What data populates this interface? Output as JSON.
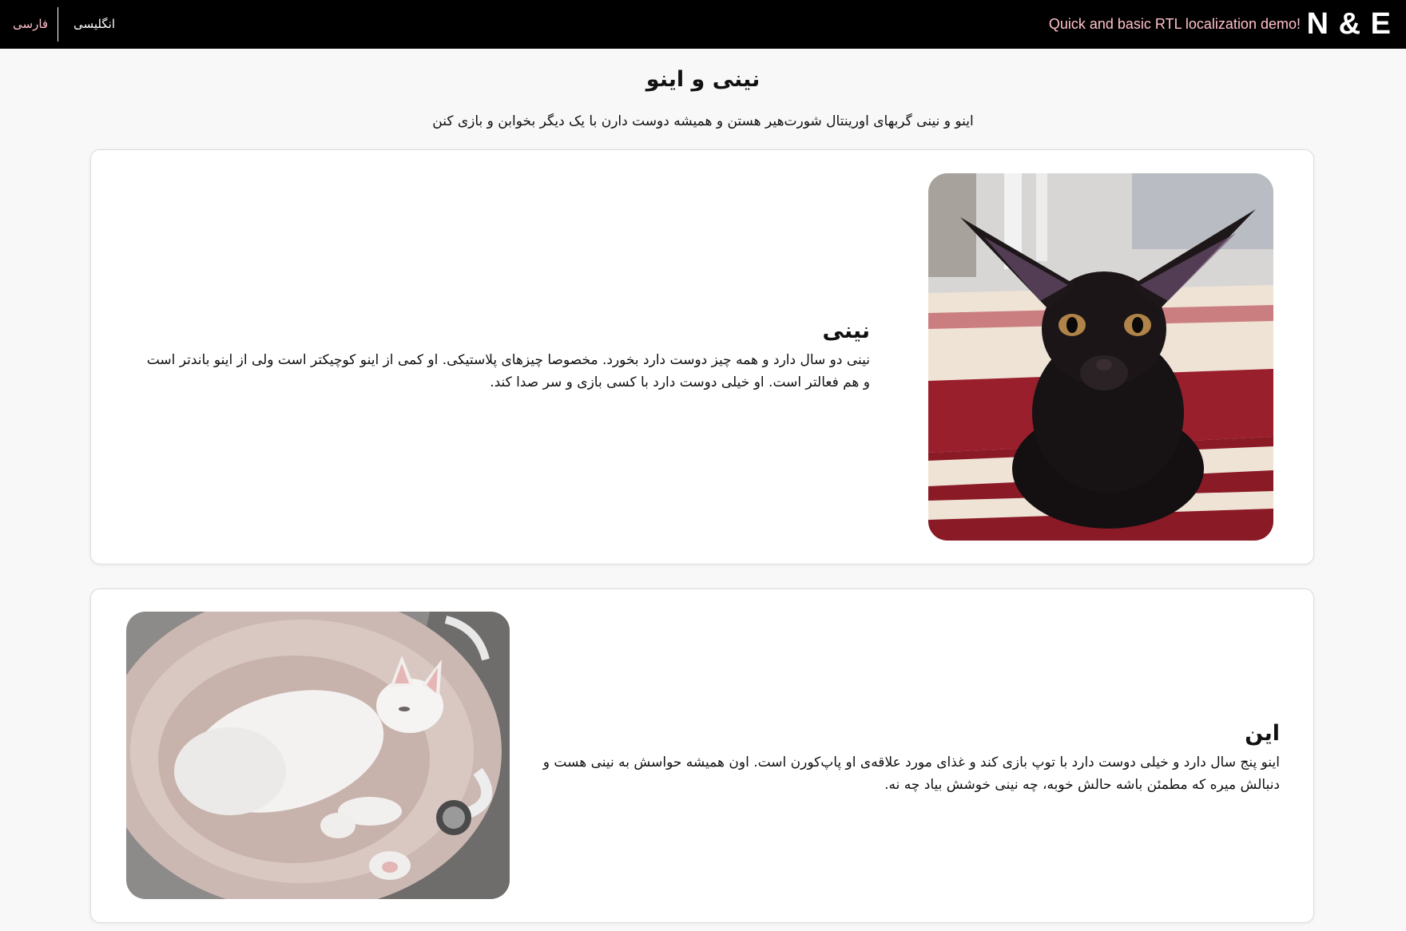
{
  "header": {
    "brand": "N & E",
    "tagline": "Quick and basic RTL localization demo!",
    "languages": [
      {
        "label": "فارسی",
        "active": true
      },
      {
        "label": "انگلیسی",
        "active": false
      }
    ]
  },
  "colors": {
    "header_bg": "#000000",
    "accent_pink": "#ffc0cb",
    "page_bg": "#f8f8f8",
    "card_bg": "#ffffff"
  },
  "page": {
    "title": "نینی و اینو",
    "intro": "اینو و نینی گربهای اورینتال شورت‌هیر هستن و همیشه دوست دارن با یک دیگر بخوابن و بازی کنن"
  },
  "cats": [
    {
      "name": "نینی",
      "description": "نینی دو سال دارد و همه چیز دوست دارد بخورد. مخصوصا چیزهای پلاستیکی. او کمی از اینو کوچیکتر است ولی از اینو باندتر است و هم فعالتر است. او خیلی دوست دارد با کسی بازی و سر صدا کند.",
      "photo": "black-oriental-cat-photo"
    },
    {
      "name": "این",
      "description": "اینو پنج سال دارد و خیلی دوست دارد با توپ بازی کند و غذای مورد علاقه‌ی او پاپ‌کورن است. اون همیشه حواسش به نینی هست و دنبالش میره که مطمئن باشه حالش خوبه، چه نینی خوشش بیاد چه نه.",
      "photo": "white-oriental-cat-photo"
    }
  ]
}
